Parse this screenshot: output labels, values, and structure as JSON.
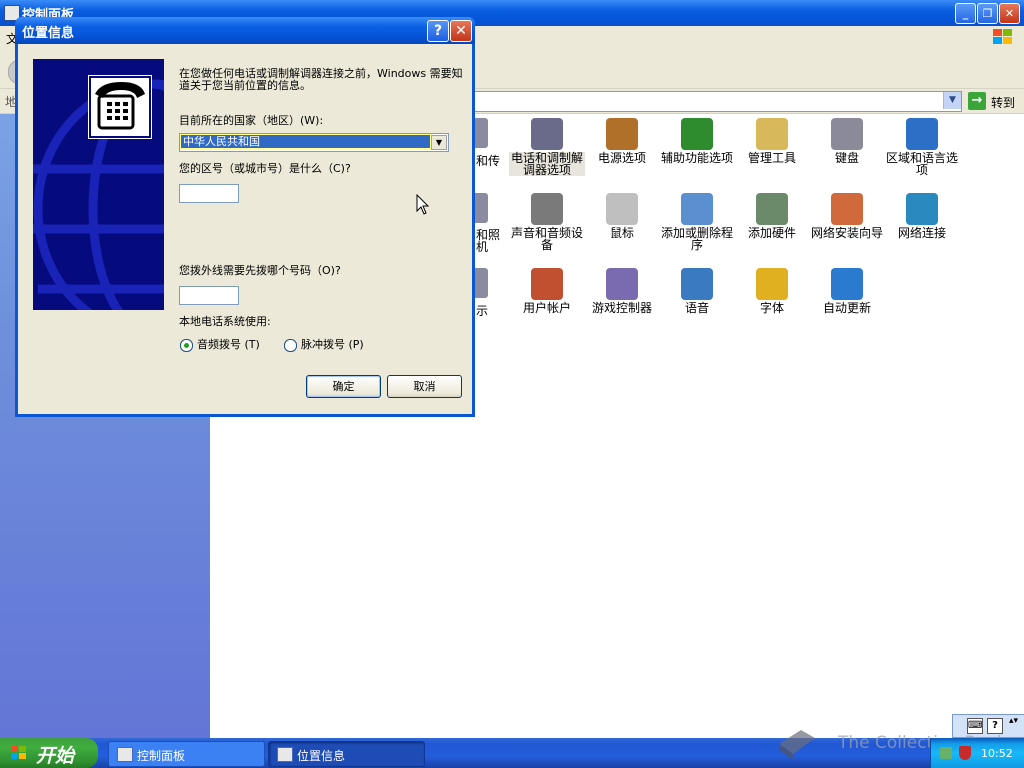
{
  "background_window": {
    "title": "控制面板",
    "menu_first": "文",
    "address_label": "地",
    "go_label": "转到",
    "icons": [
      {
        "id": "phone-modem",
        "label": "电话和调制解调器选项",
        "selected": true,
        "color": "#6a6a8a"
      },
      {
        "id": "power",
        "label": "电源选项",
        "color": "#b0702a"
      },
      {
        "id": "accessibility",
        "label": "辅助功能选项",
        "color": "#2e8b2e"
      },
      {
        "id": "admin-tools",
        "label": "管理工具",
        "color": "#d7b85a"
      },
      {
        "id": "keyboard",
        "label": "键盘",
        "color": "#8a8a9a"
      },
      {
        "id": "regional",
        "label": "区域和语言选项",
        "color": "#2b6fc6"
      },
      {
        "id": "sound",
        "label": "声音和音频设备",
        "color": "#7a7a7a"
      },
      {
        "id": "mouse",
        "label": "鼠标",
        "color": "#bfbfbf"
      },
      {
        "id": "add-remove",
        "label": "添加或删除程序",
        "color": "#5a8fd0"
      },
      {
        "id": "add-hardware",
        "label": "添加硬件",
        "color": "#6a8a6a"
      },
      {
        "id": "network-setup",
        "label": "网络安装向导",
        "color": "#d06a3a"
      },
      {
        "id": "network-conn",
        "label": "网络连接",
        "color": "#2a8ac0"
      },
      {
        "id": "user-accounts",
        "label": "用户帐户",
        "color": "#c05030"
      },
      {
        "id": "game-controllers",
        "label": "游戏控制器",
        "color": "#7a6ab0"
      },
      {
        "id": "speech",
        "label": "语音",
        "color": "#3a7ac0"
      },
      {
        "id": "fonts",
        "label": "字体",
        "color": "#e0b020"
      },
      {
        "id": "auto-update",
        "label": "自动更新",
        "color": "#2a7ad0"
      }
    ],
    "partial_labels": {
      "row1": "和传",
      "row1b": "",
      "row2": "和照",
      "row2b": "机",
      "row3": "示"
    }
  },
  "dialog": {
    "title": "位置信息",
    "help": "?",
    "close": "✕",
    "intro": "在您做任何电话或调制解调器连接之前，Windows 需要知道关于您当前位置的信息。",
    "country_label": "目前所在的国家（地区）(W):",
    "country_value": "中华人民共和国",
    "area_label": "您的区号（或城市号）是什么（C)?",
    "area_value": "",
    "outside_label": "您拨外线需要先拨哪个号码（O)?",
    "outside_value": "",
    "phone_system_label": "本地电话系统使用:",
    "tone_label": "音频拨号 (T)",
    "pulse_label": "脉冲拨号 (P)",
    "dial_mode": "tone",
    "ok_label": "确定",
    "cancel_label": "取消"
  },
  "taskbar": {
    "start_label": "开始",
    "tasks": [
      {
        "label": "控制面板",
        "active": false
      },
      {
        "label": "位置信息",
        "active": true
      }
    ],
    "clock": "10:52",
    "watermark": "The Collection Book"
  }
}
